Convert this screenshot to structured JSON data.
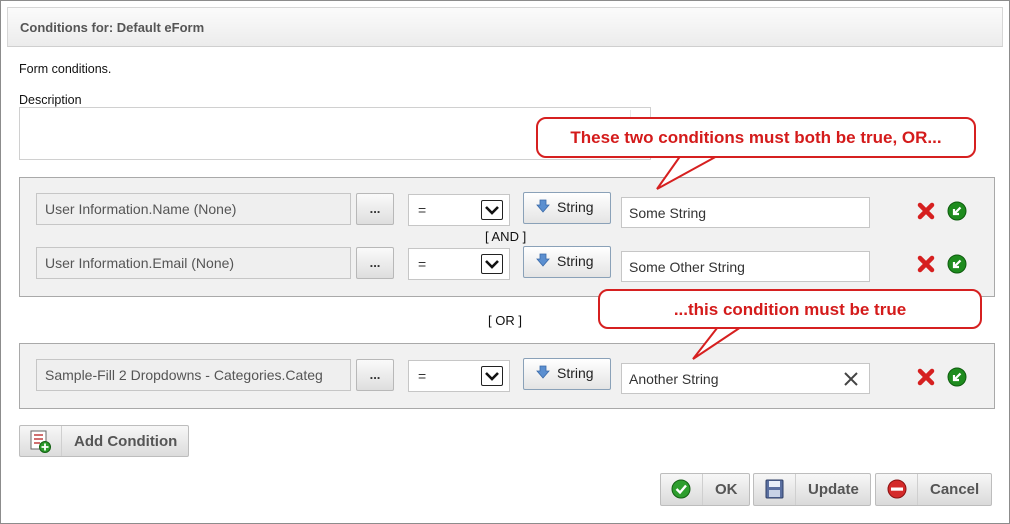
{
  "dialog": {
    "title": "Conditions for: Default eForm",
    "subtitle": "Form conditions.",
    "description_label": "Description",
    "description_value": ""
  },
  "groups": [
    {
      "rows": [
        {
          "field": "User Information.Name (None)",
          "browse": "...",
          "operator": "=",
          "type": "String",
          "value": "Some String"
        },
        {
          "field": "User Information.Email (None)",
          "browse": "...",
          "operator": "=",
          "type": "String",
          "value": "Some Other String"
        }
      ],
      "joiner": "[ AND ]"
    },
    {
      "rows": [
        {
          "field": "Sample-Fill 2 Dropdowns - Categories.Categ",
          "browse": "...",
          "operator": "=",
          "type": "String",
          "value": "Another String"
        }
      ]
    }
  ],
  "group_joiner": "[ OR ]",
  "callouts": [
    {
      "text": "These two conditions must both be true, OR..."
    },
    {
      "text": "...this condition must be true"
    }
  ],
  "buttons": {
    "add_condition": "Add Condition",
    "ok": "OK",
    "update": "Update",
    "cancel": "Cancel"
  },
  "icons": {
    "delete": "red-x-icon",
    "move": "green-arrow-icon",
    "type": "blue-down-arrow-icon",
    "clear": "clear-x-icon"
  },
  "colors": {
    "callout": "#d62020",
    "delete": "#d62020",
    "move": "#1a8a1a"
  }
}
